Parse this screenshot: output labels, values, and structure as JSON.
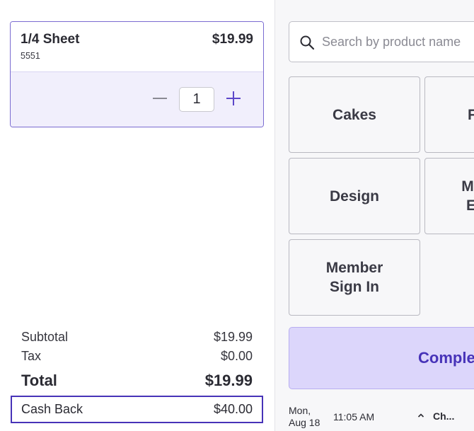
{
  "cart": {
    "item": {
      "name": "1/4 Sheet",
      "price": "$19.99",
      "sku": "5551",
      "quantity": "1"
    }
  },
  "totals": {
    "subtotal_label": "Subtotal",
    "subtotal_value": "$19.99",
    "tax_label": "Tax",
    "tax_value": "$0.00",
    "total_label": "Total",
    "total_value": "$19.99",
    "cashback_label": "Cash Back",
    "cashback_value": "$40.00"
  },
  "search": {
    "placeholder": "Search by product name"
  },
  "categories": {
    "cakes": "Cakes",
    "design": "Design",
    "member_line1": "Member",
    "member_line2": "Sign In",
    "partial_1": "F",
    "partial_2_line1": "M",
    "partial_2_line2": "E"
  },
  "actions": {
    "complete_label": "Comple"
  },
  "status_bar": {
    "day": "Mon,",
    "date": "Aug 18",
    "time": "11:05 AM",
    "menu_label": "Ch..."
  },
  "colors": {
    "accent": "#4733b8",
    "accent_light": "#dcd6fb",
    "item_highlight": "#f1effc"
  },
  "icons": {
    "search": "search-icon",
    "minus": "minus-icon",
    "plus": "plus-icon",
    "chevron": "chevron-up-icon"
  }
}
